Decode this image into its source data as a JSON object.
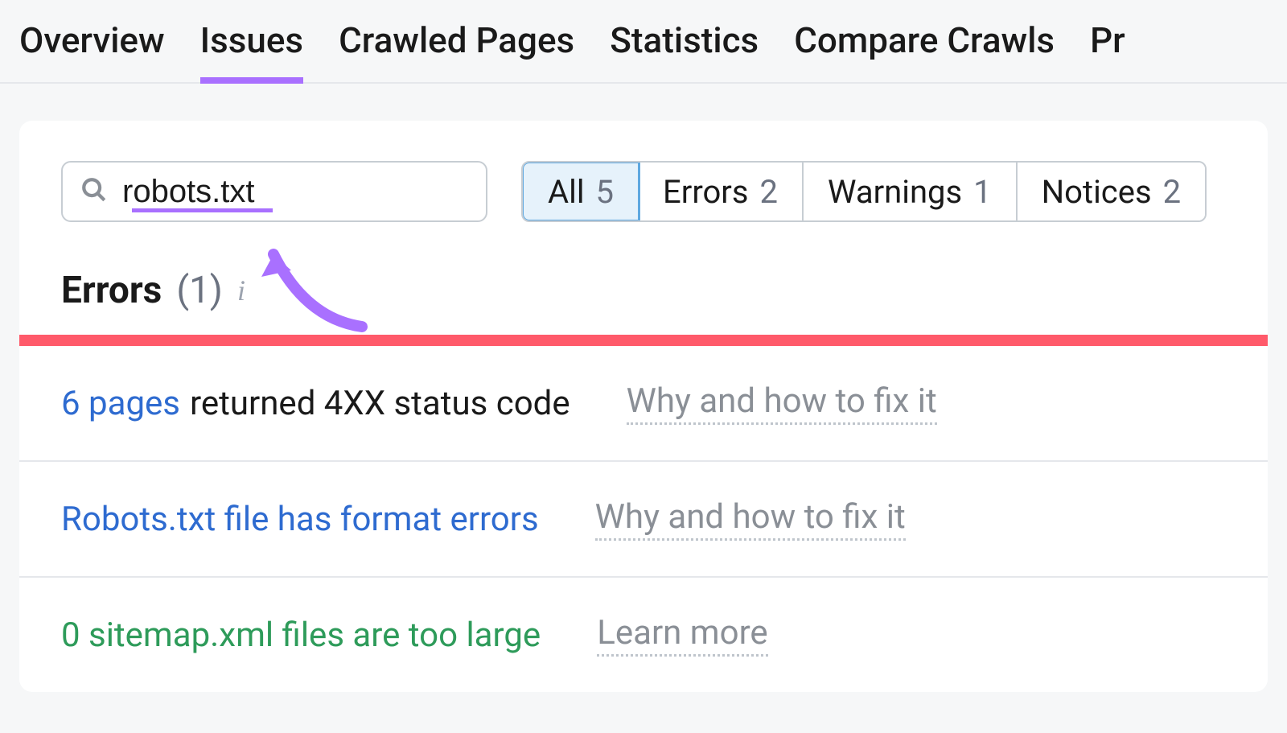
{
  "tabs": {
    "overview": "Overview",
    "issues": "Issues",
    "crawled_pages": "Crawled Pages",
    "statistics": "Statistics",
    "compare_crawls": "Compare Crawls",
    "progress": "Pr"
  },
  "search": {
    "value": "robots.txt"
  },
  "filters": {
    "all_label": "All",
    "all_count": "5",
    "errors_label": "Errors",
    "errors_count": "2",
    "warnings_label": "Warnings",
    "warnings_count": "1",
    "notices_label": "Notices",
    "notices_count": "2"
  },
  "errors_section": {
    "title": "Errors",
    "count": "(1)"
  },
  "issues": [
    {
      "link": "6 pages",
      "link_color": "blue",
      "text": "returned 4XX status code",
      "help": "Why and how to fix it"
    },
    {
      "link": "Robots.txt file has format errors",
      "link_color": "blue",
      "text": "",
      "help": "Why and how to fix it"
    },
    {
      "link": "0 sitemap.xml files are too large",
      "link_color": "green",
      "text": "",
      "help": "Learn more"
    }
  ]
}
